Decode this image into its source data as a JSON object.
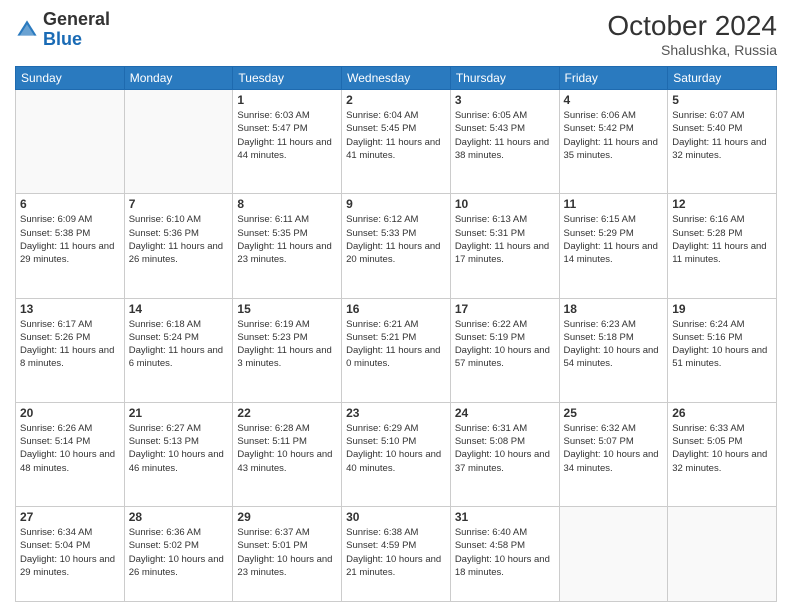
{
  "header": {
    "logo": {
      "general": "General",
      "blue": "Blue"
    },
    "title": "October 2024",
    "location": "Shalushka, Russia"
  },
  "calendar": {
    "days_of_week": [
      "Sunday",
      "Monday",
      "Tuesday",
      "Wednesday",
      "Thursday",
      "Friday",
      "Saturday"
    ],
    "weeks": [
      [
        {
          "day": "",
          "sunrise": "",
          "sunset": "",
          "daylight": "",
          "empty": true
        },
        {
          "day": "",
          "sunrise": "",
          "sunset": "",
          "daylight": "",
          "empty": true
        },
        {
          "day": "1",
          "sunrise": "Sunrise: 6:03 AM",
          "sunset": "Sunset: 5:47 PM",
          "daylight": "Daylight: 11 hours and 44 minutes.",
          "empty": false
        },
        {
          "day": "2",
          "sunrise": "Sunrise: 6:04 AM",
          "sunset": "Sunset: 5:45 PM",
          "daylight": "Daylight: 11 hours and 41 minutes.",
          "empty": false
        },
        {
          "day": "3",
          "sunrise": "Sunrise: 6:05 AM",
          "sunset": "Sunset: 5:43 PM",
          "daylight": "Daylight: 11 hours and 38 minutes.",
          "empty": false
        },
        {
          "day": "4",
          "sunrise": "Sunrise: 6:06 AM",
          "sunset": "Sunset: 5:42 PM",
          "daylight": "Daylight: 11 hours and 35 minutes.",
          "empty": false
        },
        {
          "day": "5",
          "sunrise": "Sunrise: 6:07 AM",
          "sunset": "Sunset: 5:40 PM",
          "daylight": "Daylight: 11 hours and 32 minutes.",
          "empty": false
        }
      ],
      [
        {
          "day": "6",
          "sunrise": "Sunrise: 6:09 AM",
          "sunset": "Sunset: 5:38 PM",
          "daylight": "Daylight: 11 hours and 29 minutes.",
          "empty": false
        },
        {
          "day": "7",
          "sunrise": "Sunrise: 6:10 AM",
          "sunset": "Sunset: 5:36 PM",
          "daylight": "Daylight: 11 hours and 26 minutes.",
          "empty": false
        },
        {
          "day": "8",
          "sunrise": "Sunrise: 6:11 AM",
          "sunset": "Sunset: 5:35 PM",
          "daylight": "Daylight: 11 hours and 23 minutes.",
          "empty": false
        },
        {
          "day": "9",
          "sunrise": "Sunrise: 6:12 AM",
          "sunset": "Sunset: 5:33 PM",
          "daylight": "Daylight: 11 hours and 20 minutes.",
          "empty": false
        },
        {
          "day": "10",
          "sunrise": "Sunrise: 6:13 AM",
          "sunset": "Sunset: 5:31 PM",
          "daylight": "Daylight: 11 hours and 17 minutes.",
          "empty": false
        },
        {
          "day": "11",
          "sunrise": "Sunrise: 6:15 AM",
          "sunset": "Sunset: 5:29 PM",
          "daylight": "Daylight: 11 hours and 14 minutes.",
          "empty": false
        },
        {
          "day": "12",
          "sunrise": "Sunrise: 6:16 AM",
          "sunset": "Sunset: 5:28 PM",
          "daylight": "Daylight: 11 hours and 11 minutes.",
          "empty": false
        }
      ],
      [
        {
          "day": "13",
          "sunrise": "Sunrise: 6:17 AM",
          "sunset": "Sunset: 5:26 PM",
          "daylight": "Daylight: 11 hours and 8 minutes.",
          "empty": false
        },
        {
          "day": "14",
          "sunrise": "Sunrise: 6:18 AM",
          "sunset": "Sunset: 5:24 PM",
          "daylight": "Daylight: 11 hours and 6 minutes.",
          "empty": false
        },
        {
          "day": "15",
          "sunrise": "Sunrise: 6:19 AM",
          "sunset": "Sunset: 5:23 PM",
          "daylight": "Daylight: 11 hours and 3 minutes.",
          "empty": false
        },
        {
          "day": "16",
          "sunrise": "Sunrise: 6:21 AM",
          "sunset": "Sunset: 5:21 PM",
          "daylight": "Daylight: 11 hours and 0 minutes.",
          "empty": false
        },
        {
          "day": "17",
          "sunrise": "Sunrise: 6:22 AM",
          "sunset": "Sunset: 5:19 PM",
          "daylight": "Daylight: 10 hours and 57 minutes.",
          "empty": false
        },
        {
          "day": "18",
          "sunrise": "Sunrise: 6:23 AM",
          "sunset": "Sunset: 5:18 PM",
          "daylight": "Daylight: 10 hours and 54 minutes.",
          "empty": false
        },
        {
          "day": "19",
          "sunrise": "Sunrise: 6:24 AM",
          "sunset": "Sunset: 5:16 PM",
          "daylight": "Daylight: 10 hours and 51 minutes.",
          "empty": false
        }
      ],
      [
        {
          "day": "20",
          "sunrise": "Sunrise: 6:26 AM",
          "sunset": "Sunset: 5:14 PM",
          "daylight": "Daylight: 10 hours and 48 minutes.",
          "empty": false
        },
        {
          "day": "21",
          "sunrise": "Sunrise: 6:27 AM",
          "sunset": "Sunset: 5:13 PM",
          "daylight": "Daylight: 10 hours and 46 minutes.",
          "empty": false
        },
        {
          "day": "22",
          "sunrise": "Sunrise: 6:28 AM",
          "sunset": "Sunset: 5:11 PM",
          "daylight": "Daylight: 10 hours and 43 minutes.",
          "empty": false
        },
        {
          "day": "23",
          "sunrise": "Sunrise: 6:29 AM",
          "sunset": "Sunset: 5:10 PM",
          "daylight": "Daylight: 10 hours and 40 minutes.",
          "empty": false
        },
        {
          "day": "24",
          "sunrise": "Sunrise: 6:31 AM",
          "sunset": "Sunset: 5:08 PM",
          "daylight": "Daylight: 10 hours and 37 minutes.",
          "empty": false
        },
        {
          "day": "25",
          "sunrise": "Sunrise: 6:32 AM",
          "sunset": "Sunset: 5:07 PM",
          "daylight": "Daylight: 10 hours and 34 minutes.",
          "empty": false
        },
        {
          "day": "26",
          "sunrise": "Sunrise: 6:33 AM",
          "sunset": "Sunset: 5:05 PM",
          "daylight": "Daylight: 10 hours and 32 minutes.",
          "empty": false
        }
      ],
      [
        {
          "day": "27",
          "sunrise": "Sunrise: 6:34 AM",
          "sunset": "Sunset: 5:04 PM",
          "daylight": "Daylight: 10 hours and 29 minutes.",
          "empty": false
        },
        {
          "day": "28",
          "sunrise": "Sunrise: 6:36 AM",
          "sunset": "Sunset: 5:02 PM",
          "daylight": "Daylight: 10 hours and 26 minutes.",
          "empty": false
        },
        {
          "day": "29",
          "sunrise": "Sunrise: 6:37 AM",
          "sunset": "Sunset: 5:01 PM",
          "daylight": "Daylight: 10 hours and 23 minutes.",
          "empty": false
        },
        {
          "day": "30",
          "sunrise": "Sunrise: 6:38 AM",
          "sunset": "Sunset: 4:59 PM",
          "daylight": "Daylight: 10 hours and 21 minutes.",
          "empty": false
        },
        {
          "day": "31",
          "sunrise": "Sunrise: 6:40 AM",
          "sunset": "Sunset: 4:58 PM",
          "daylight": "Daylight: 10 hours and 18 minutes.",
          "empty": false
        },
        {
          "day": "",
          "sunrise": "",
          "sunset": "",
          "daylight": "",
          "empty": true
        },
        {
          "day": "",
          "sunrise": "",
          "sunset": "",
          "daylight": "",
          "empty": true
        }
      ]
    ]
  }
}
